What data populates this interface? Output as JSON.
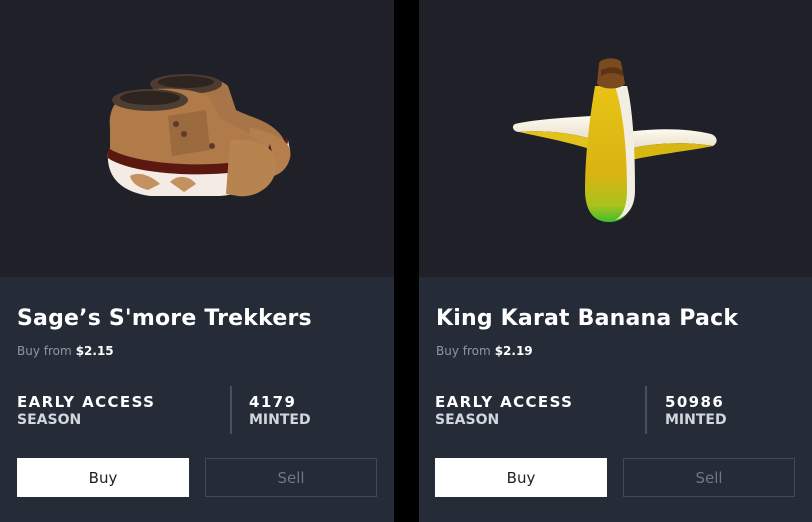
{
  "cards": [
    {
      "item_name": "Sage’s S'more Trekkers",
      "buy_from_label": "Buy from",
      "price": "$2.15",
      "season_value": "EARLY ACCESS",
      "season_label": "SEASON",
      "minted_value": "4179",
      "minted_label": "MINTED",
      "buy_label": "Buy",
      "sell_label": "Sell"
    },
    {
      "item_name": "King Karat Banana Pack",
      "buy_from_label": "Buy from",
      "price": "$2.19",
      "season_value": "EARLY ACCESS",
      "season_label": "SEASON",
      "minted_value": "50986",
      "minted_label": "MINTED",
      "buy_label": "Buy",
      "sell_label": "Sell"
    }
  ],
  "colors": {
    "page_background": "#000000",
    "card_background": "#252c37",
    "image_background": "#202128",
    "buy_button": "#ffffff",
    "muted_text": "#8f96a1"
  }
}
